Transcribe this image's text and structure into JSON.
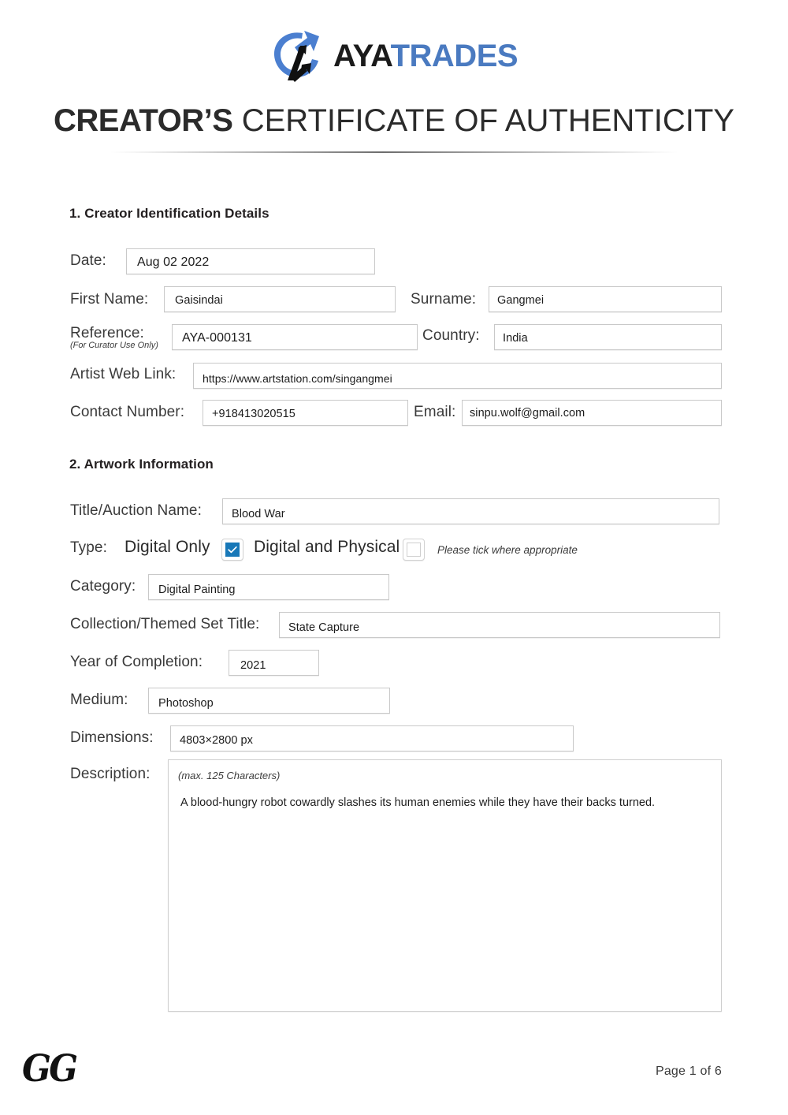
{
  "brand": {
    "logo_icon": "ayatrades-swoosh-logo",
    "name_part1": "AYA",
    "name_part2": "TRADES",
    "accent_color": "#4a7ac0",
    "checkbox_color": "#1878b8"
  },
  "header": {
    "title_strong": "CREATOR’S",
    "title_light": "CERTIFICATE OF AUTHENTICITY"
  },
  "section1": {
    "heading": "1. Creator Identification Details",
    "fields": {
      "date_label": "Date:",
      "date_value": "Aug 02 2022",
      "first_name_label": "First Name:",
      "first_name_value": "Gaisindai",
      "surname_label": "Surname:",
      "surname_value": "Gangmei",
      "reference_label": "Reference:",
      "reference_sub": "(For Curator Use Only)",
      "reference_value": "AYA-000131",
      "country_label": "Country:",
      "country_value": "India",
      "web_link_label": "Artist Web Link:",
      "web_link_value": "https://www.artstation.com/singangmei",
      "contact_label": "Contact Number:",
      "contact_value": "+918413020515",
      "email_label": "Email:",
      "email_value": "sinpu.wolf@gmail.com"
    }
  },
  "section2": {
    "heading": "2. Artwork Information",
    "fields": {
      "title_label": "Title/Auction Name:",
      "title_value": "Blood War",
      "type_label": "Type:",
      "type_option_1": "Digital Only",
      "type_option_2": "Digital and Physical",
      "type_note": "Please tick where appropriate",
      "type_option_1_checked": true,
      "type_option_2_checked": false,
      "category_label": "Category:",
      "category_value": "Digital Painting",
      "collection_label": "Collection/Themed Set Title:",
      "collection_value": "State Capture",
      "year_label": "Year of Completion:",
      "year_value": "2021",
      "medium_label": "Medium:",
      "medium_value": "Photoshop",
      "dimensions_label": "Dimensions:",
      "dimensions_value": "4803×2800 px",
      "description_label": "Description:",
      "description_hint": "(max. 125 Characters)",
      "description_value": "A blood-hungry robot cowardly slashes its human enemies while they have their backs turned."
    }
  },
  "footer": {
    "signature": "GG",
    "page_number": "Page 1 of 6"
  }
}
